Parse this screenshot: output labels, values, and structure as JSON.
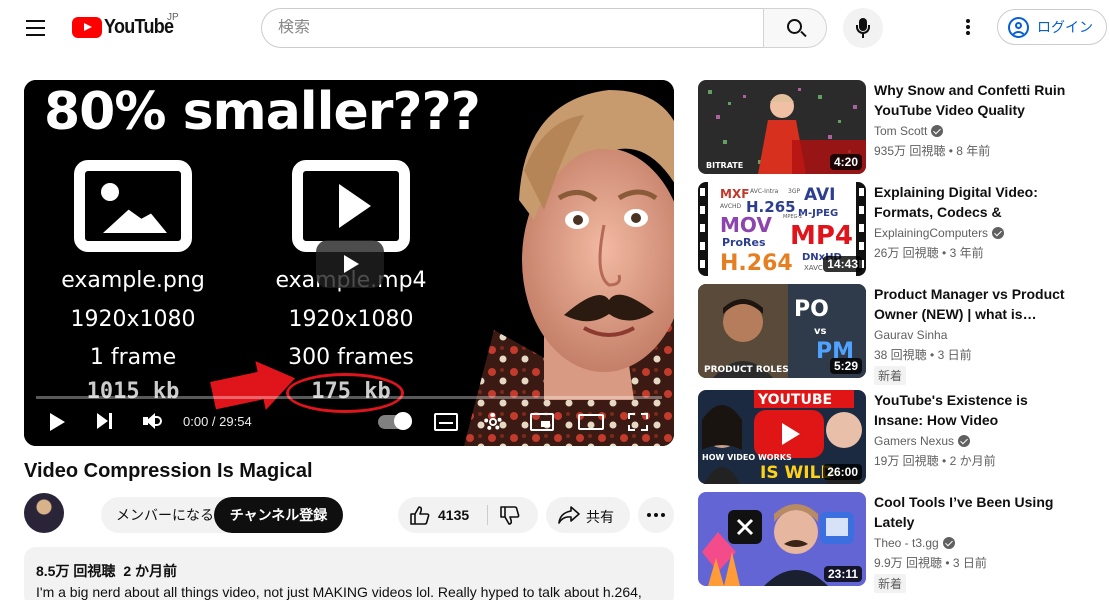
{
  "header": {
    "logo_text": "YouTube",
    "region": "JP",
    "search_placeholder": "検索",
    "login_label": "ログイン"
  },
  "player": {
    "thumbnail": {
      "headline": "80% smaller???",
      "left_col": [
        "example.png",
        "1920x1080",
        "1 frame",
        "1015 kb"
      ],
      "right_col": [
        "example.mp4",
        "1920x1080",
        "300 frames",
        "175 kb"
      ]
    },
    "time": "0:00 / 29:54",
    "progress": 0
  },
  "video": {
    "title": "Video Compression Is Magical",
    "member_label": "メンバーになる",
    "subscribe_label": "チャンネル登録",
    "like_count": "4135",
    "share_label": "共有"
  },
  "description": {
    "views": "8.5万 回視聴",
    "date": "2 か月前",
    "text": "I'm a big nerd about all things video, not just MAKING videos lol. Really hyped to talk about h.264,"
  },
  "recommendations": [
    {
      "title": "Why Snow and Confetti Ruin YouTube Video Quality",
      "channel": "Tom Scott",
      "verified": true,
      "views": "935万 回視聴",
      "age": "8 年前",
      "duration": "4:20",
      "badge": ""
    },
    {
      "title": "Explaining Digital Video: Formats, Codecs & Containers",
      "channel": "ExplainingComputers",
      "verified": true,
      "views": "26万 回視聴",
      "age": "3 年前",
      "duration": "14:43",
      "badge": ""
    },
    {
      "title": "Product Manager vs Product Owner (NEW) | what is…",
      "channel": "Gaurav Sinha",
      "verified": false,
      "views": "38 回視聴",
      "age": "3 日前",
      "duration": "5:29",
      "badge": "新着",
      "thumb_text": [
        "PO",
        "vs",
        "PM",
        "PRODUCT ROLES"
      ]
    },
    {
      "title": "YouTube's Existence is Insane: How Video Compression,…",
      "channel": "Gamers Nexus",
      "verified": true,
      "views": "19万 回視聴",
      "age": "2 か月前",
      "duration": "26:00",
      "badge": "",
      "thumb_text": [
        "YOUTUBE",
        "HOW VIDEO WORKS",
        "IS WILD"
      ]
    },
    {
      "title": "Cool Tools I’ve Been Using Lately",
      "channel": "Theo - t3.gg",
      "verified": true,
      "views": "9.9万 回視聴",
      "age": "3 日前",
      "duration": "23:11",
      "badge": "新着"
    }
  ],
  "thumb2_words": [
    "MXF",
    "AVC-Intra",
    "3GP",
    "AVI",
    "AVCHD",
    "H.265",
    "MPEG-2",
    "M-JPEG",
    "MOV",
    "MP4",
    "ProRes",
    "DNxHD",
    "H.264",
    "XAVC"
  ],
  "thumb1_label": "BITRATE",
  "colors": {
    "brand": "#ff0000",
    "link": "#065fd4",
    "progress": "#ff0000"
  }
}
